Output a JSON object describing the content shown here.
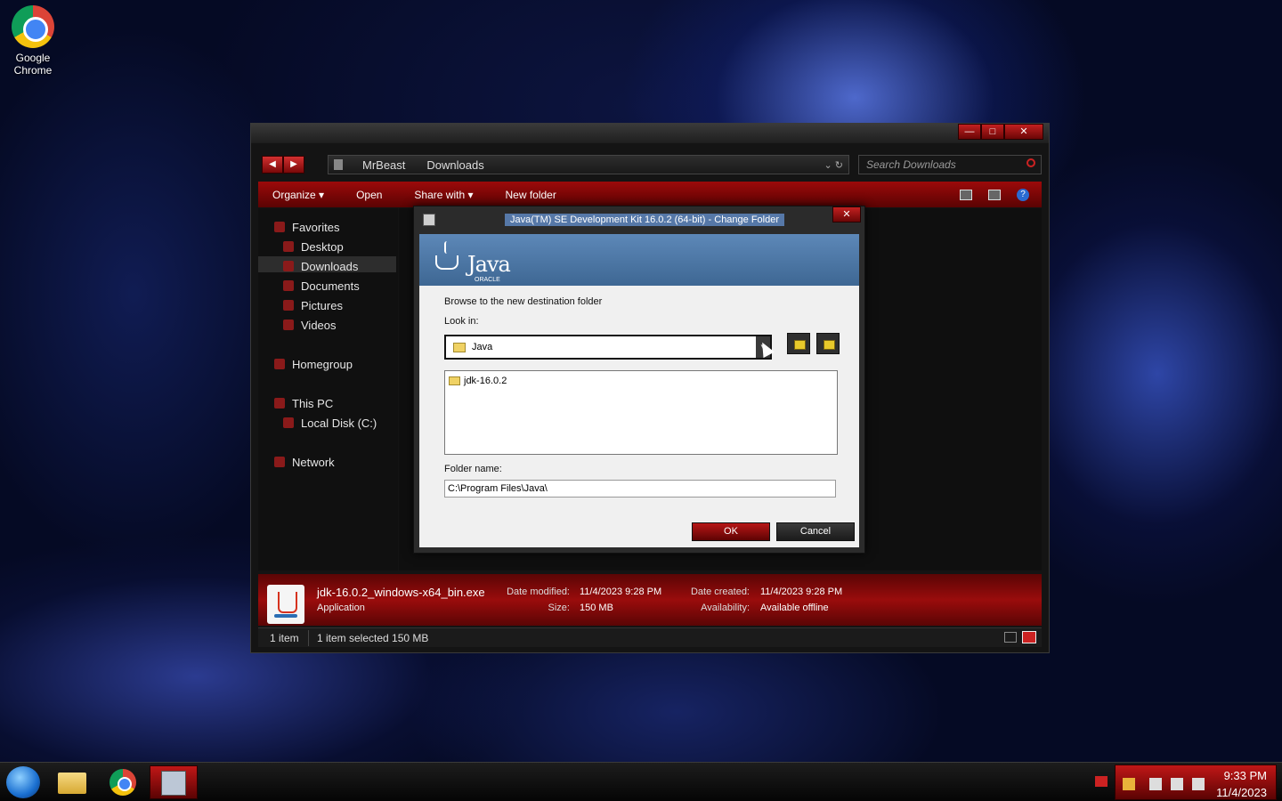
{
  "desktop": {
    "icons": [
      {
        "label_line1": "Google",
        "label_line2": "Chrome",
        "icon": "chrome-icon"
      }
    ]
  },
  "explorer": {
    "window_controls": {
      "minimize": "—",
      "maximize": "□",
      "close": "✕"
    },
    "nav": {
      "back": "◀",
      "forward": "▶"
    },
    "breadcrumb": [
      "MrBeast",
      "Downloads"
    ],
    "address_tail": "⌄  ↻",
    "search_placeholder": "Search Downloads",
    "toolbar": {
      "organize": "Organize ▾",
      "open": "Open",
      "share_with": "Share with ▾",
      "new_folder": "New folder"
    },
    "sidebar": {
      "favorites": "Favorites",
      "desktop": "Desktop",
      "downloads": "Downloads",
      "documents": "Documents",
      "pictures": "Pictures",
      "videos": "Videos",
      "homegroup": "Homegroup",
      "this_pc": "This PC",
      "local_disk": "Local Disk (C:)",
      "network": "Network"
    },
    "details": {
      "file_name": "jdk-16.0.2_windows-x64_bin.exe",
      "file_type": "Application",
      "date_modified_label": "Date modified:",
      "date_modified": "11/4/2023 9:28 PM",
      "size_label": "Size:",
      "size": "150 MB",
      "date_created_label": "Date created:",
      "date_created": "11/4/2023 9:28 PM",
      "availability_label": "Availability:",
      "availability": "Available offline"
    },
    "status": {
      "item_count": "1 item",
      "selection": "1 item selected  150 MB"
    }
  },
  "dialog": {
    "title": "Java(TM) SE Development Kit 16.0.2 (64-bit) - Change Folder",
    "close": "✕",
    "brand_word": "Java",
    "brand_sub": "ORACLE",
    "prompt": "Browse to the new destination folder",
    "look_in_label": "Look in:",
    "look_in_value": "Java",
    "combo_arrow": "▼",
    "folders": [
      "jdk-16.0.2"
    ],
    "folder_name_label": "Folder name:",
    "folder_name_value": "C:\\Program Files\\Java\\",
    "ok_label": "OK",
    "cancel_label": "Cancel"
  },
  "taskbar": {
    "clock_time": "9:33 PM",
    "clock_date": "11/4/2023"
  }
}
